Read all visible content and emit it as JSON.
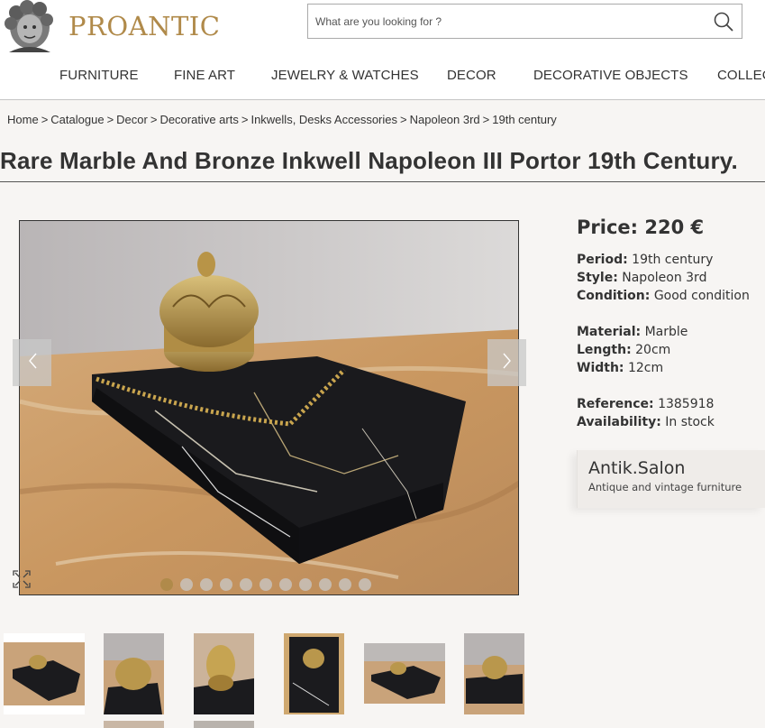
{
  "header": {
    "logo_text": "PROANTIC",
    "search_placeholder": "What are you looking for ?"
  },
  "nav": {
    "items": [
      {
        "label": "FURNITURE"
      },
      {
        "label": "FINE ART"
      },
      {
        "label": "JEWELRY & WATCHES"
      },
      {
        "label": "DECOR"
      },
      {
        "label": "DECORATIVE OBJECTS"
      },
      {
        "label": "COLLEC"
      }
    ]
  },
  "breadcrumb": {
    "items": [
      "Home",
      "Catalogue",
      "Decor",
      "Decorative arts",
      "Inkwells, Desks Accessories",
      "Napoleon 3rd",
      "19th century"
    ],
    "separator": ">"
  },
  "product": {
    "title": "Rare Marble And Bronze Inkwell Napoleon III Portor 19th Century.",
    "price_label": "Price: 220 €",
    "specs": [
      {
        "label": "Period:",
        "value": "19th century"
      },
      {
        "label": "Style:",
        "value": "Napoleon 3rd"
      },
      {
        "label": "Condition:",
        "value": "Good condition"
      },
      {
        "label": "Material:",
        "value": "Marble"
      },
      {
        "label": "Length:",
        "value": "20cm"
      },
      {
        "label": "Width:",
        "value": "12cm"
      },
      {
        "label": "Reference:",
        "value": "1385918"
      },
      {
        "label": "Availability:",
        "value": "In stock"
      }
    ]
  },
  "gallery": {
    "slide_count": 11,
    "active_slide": 1,
    "icons": {
      "prev": "chevron-left-icon",
      "next": "chevron-right-icon",
      "expand": "expand-icon",
      "search": "search-icon"
    }
  },
  "seller": {
    "name": "Antik.Salon",
    "description": "Antique and vintage furniture"
  },
  "colors": {
    "brand_gold": "#b08a4a",
    "background": "#f7f5f3",
    "text": "#333333"
  }
}
